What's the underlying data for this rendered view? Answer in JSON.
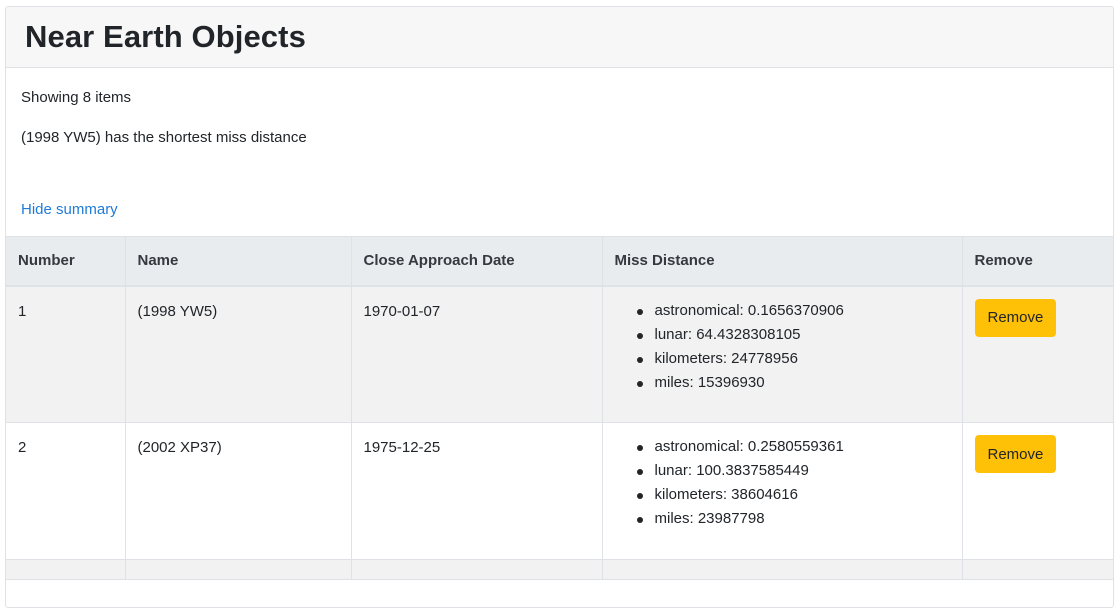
{
  "header": {
    "title": "Near Earth Objects"
  },
  "summary": {
    "count_text": "Showing 8 items",
    "shortest_text": "(1998 YW5) has the shortest miss distance",
    "toggle_label": "Hide summary"
  },
  "table": {
    "columns": [
      "Number",
      "Name",
      "Close Approach Date",
      "Miss Distance",
      "Remove"
    ],
    "rows": [
      {
        "number": "1",
        "name": "(1998 YW5)",
        "date": "1970-01-07",
        "miss": {
          "astronomical": "astronomical: 0.1656370906",
          "lunar": "lunar: 64.4328308105",
          "kilometers": "kilometers: 24778956",
          "miles": "miles: 15396930"
        },
        "remove_label": "Remove"
      },
      {
        "number": "2",
        "name": "(2002 XP37)",
        "date": "1975-12-25",
        "miss": {
          "astronomical": "astronomical: 0.2580559361",
          "lunar": "lunar: 100.3837585449",
          "kilometers": "kilometers: 38604616",
          "miles": "miles: 23987798"
        },
        "remove_label": "Remove"
      }
    ]
  },
  "colors": {
    "remove_button": "#ffc107",
    "link": "#1e7bd8",
    "header_bg": "#f7f7f7",
    "table_header_bg": "#e9ecef",
    "striped_row_bg": "#f2f2f2"
  }
}
